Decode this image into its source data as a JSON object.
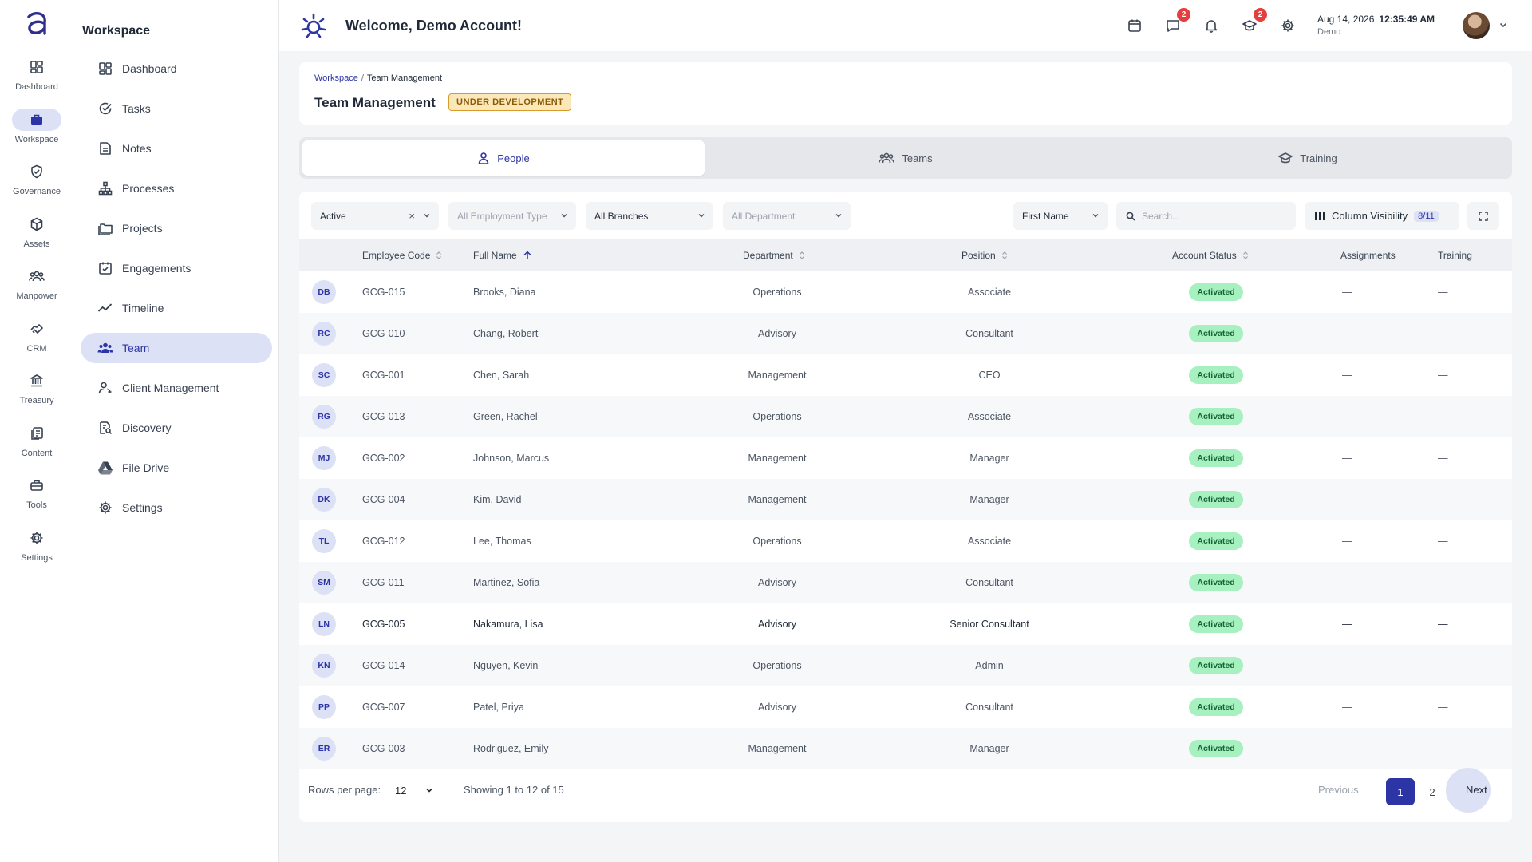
{
  "rail": {
    "items": [
      {
        "label": "Dashboard",
        "icon": "dashboard-icon"
      },
      {
        "label": "Workspace",
        "icon": "briefcase-icon",
        "active": true
      },
      {
        "label": "Governance",
        "icon": "shield-check-icon"
      },
      {
        "label": "Assets",
        "icon": "cube-icon"
      },
      {
        "label": "Manpower",
        "icon": "people-icon"
      },
      {
        "label": "CRM",
        "icon": "handshake-icon"
      },
      {
        "label": "Treasury",
        "icon": "bank-icon"
      },
      {
        "label": "Content",
        "icon": "documents-icon"
      },
      {
        "label": "Tools",
        "icon": "toolbox-icon"
      },
      {
        "label": "Settings",
        "icon": "gear-icon"
      }
    ]
  },
  "sidebar": {
    "title": "Workspace",
    "items": [
      {
        "label": "Dashboard",
        "icon": "dashboard-icon"
      },
      {
        "label": "Tasks",
        "icon": "check-circle-icon"
      },
      {
        "label": "Notes",
        "icon": "note-icon"
      },
      {
        "label": "Processes",
        "icon": "hierarchy-icon"
      },
      {
        "label": "Projects",
        "icon": "folders-icon"
      },
      {
        "label": "Engagements",
        "icon": "calendar-check-icon"
      },
      {
        "label": "Timeline",
        "icon": "trend-line-icon"
      },
      {
        "label": "Team",
        "icon": "team-icon",
        "active": true
      },
      {
        "label": "Client Management",
        "icon": "client-icon"
      },
      {
        "label": "Discovery",
        "icon": "search-doc-icon"
      },
      {
        "label": "File Drive",
        "icon": "drive-icon"
      },
      {
        "label": "Settings",
        "icon": "gear-icon"
      }
    ]
  },
  "header": {
    "welcome": "Welcome, Demo Account!",
    "messages_badge": "2",
    "training_badge": "2",
    "date": "Aug 14, 2026",
    "time": "12:35:49 AM",
    "user": "Demo"
  },
  "page": {
    "breadcrumb_root": "Workspace",
    "breadcrumb_sep": "/",
    "breadcrumb_current": "Team Management",
    "title": "Team Management",
    "badge": "UNDER DEVELOPMENT"
  },
  "tabs": [
    {
      "label": "People",
      "icon": "person-icon",
      "active": true
    },
    {
      "label": "Teams",
      "icon": "people-icon"
    },
    {
      "label": "Training",
      "icon": "graduation-cap-icon"
    }
  ],
  "filters": {
    "status": "Active",
    "employment_type": "All Employment Type",
    "branches": "All Branches",
    "department": "All Department",
    "sort_field": "First Name",
    "search_placeholder": "Search...",
    "column_visibility_label": "Column Visibility",
    "column_visibility_count": "8/11"
  },
  "table": {
    "columns": [
      "Employee Code",
      "Full Name",
      "Department",
      "Position",
      "Account Status",
      "Assignments",
      "Training"
    ],
    "rows": [
      {
        "initials": "DB",
        "code": "GCG-015",
        "name": "Brooks, Diana",
        "department": "Operations",
        "position": "Associate",
        "status": "Activated",
        "assignments": "—",
        "training": "—"
      },
      {
        "initials": "RC",
        "code": "GCG-010",
        "name": "Chang, Robert",
        "department": "Advisory",
        "position": "Consultant",
        "status": "Activated",
        "assignments": "—",
        "training": "—"
      },
      {
        "initials": "SC",
        "code": "GCG-001",
        "name": "Chen, Sarah",
        "department": "Management",
        "position": "CEO",
        "status": "Activated",
        "assignments": "—",
        "training": "—"
      },
      {
        "initials": "RG",
        "code": "GCG-013",
        "name": "Green, Rachel",
        "department": "Operations",
        "position": "Associate",
        "status": "Activated",
        "assignments": "—",
        "training": "—"
      },
      {
        "initials": "MJ",
        "code": "GCG-002",
        "name": "Johnson, Marcus",
        "department": "Management",
        "position": "Manager",
        "status": "Activated",
        "assignments": "—",
        "training": "—"
      },
      {
        "initials": "DK",
        "code": "GCG-004",
        "name": "Kim, David",
        "department": "Management",
        "position": "Manager",
        "status": "Activated",
        "assignments": "—",
        "training": "—"
      },
      {
        "initials": "TL",
        "code": "GCG-012",
        "name": "Lee, Thomas",
        "department": "Operations",
        "position": "Associate",
        "status": "Activated",
        "assignments": "—",
        "training": "—"
      },
      {
        "initials": "SM",
        "code": "GCG-011",
        "name": "Martinez, Sofia",
        "department": "Advisory",
        "position": "Consultant",
        "status": "Activated",
        "assignments": "—",
        "training": "—"
      },
      {
        "initials": "LN",
        "code": "GCG-005",
        "name": "Nakamura, Lisa",
        "department": "Advisory",
        "position": "Senior Consultant",
        "status": "Activated",
        "assignments": "—",
        "training": "—",
        "highlight": true
      },
      {
        "initials": "KN",
        "code": "GCG-014",
        "name": "Nguyen, Kevin",
        "department": "Operations",
        "position": "Admin",
        "status": "Activated",
        "assignments": "—",
        "training": "—"
      },
      {
        "initials": "PP",
        "code": "GCG-007",
        "name": "Patel, Priya",
        "department": "Advisory",
        "position": "Consultant",
        "status": "Activated",
        "assignments": "—",
        "training": "—"
      },
      {
        "initials": "ER",
        "code": "GCG-003",
        "name": "Rodriguez, Emily",
        "department": "Management",
        "position": "Manager",
        "status": "Activated",
        "assignments": "—",
        "training": "—"
      }
    ]
  },
  "pagination": {
    "rows_per_page_label": "Rows per page:",
    "rows_per_page": "12",
    "showing": "Showing 1 to 12 of 15",
    "previous": "Previous",
    "pages": [
      "1",
      "2"
    ],
    "current_page": "1",
    "next": "Next"
  }
}
